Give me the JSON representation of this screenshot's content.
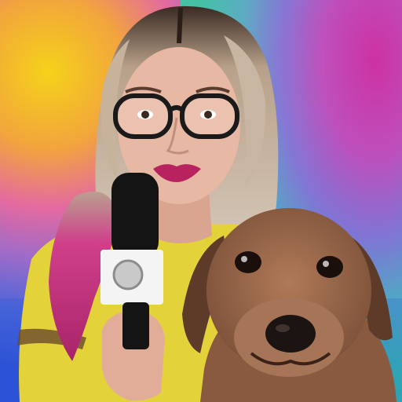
{
  "scene": {
    "subjects": [
      "woman-with-glasses",
      "microphone",
      "dog"
    ],
    "background": "rainbow-gradient",
    "colors": {
      "yellow": "#f2c21e",
      "magenta": "#e8309a",
      "purple": "#8a5cc8",
      "blue": "#2a4fd6",
      "teal": "#2fb7a4",
      "hair_blonde": "#cbb8a0",
      "hair_pink": "#c8357e",
      "skin": "#e7b8a3",
      "lips": "#b8235f",
      "shirt": "#e3d23a",
      "dog_fur": "#9b6a4c",
      "mic_black": "#141414"
    }
  }
}
